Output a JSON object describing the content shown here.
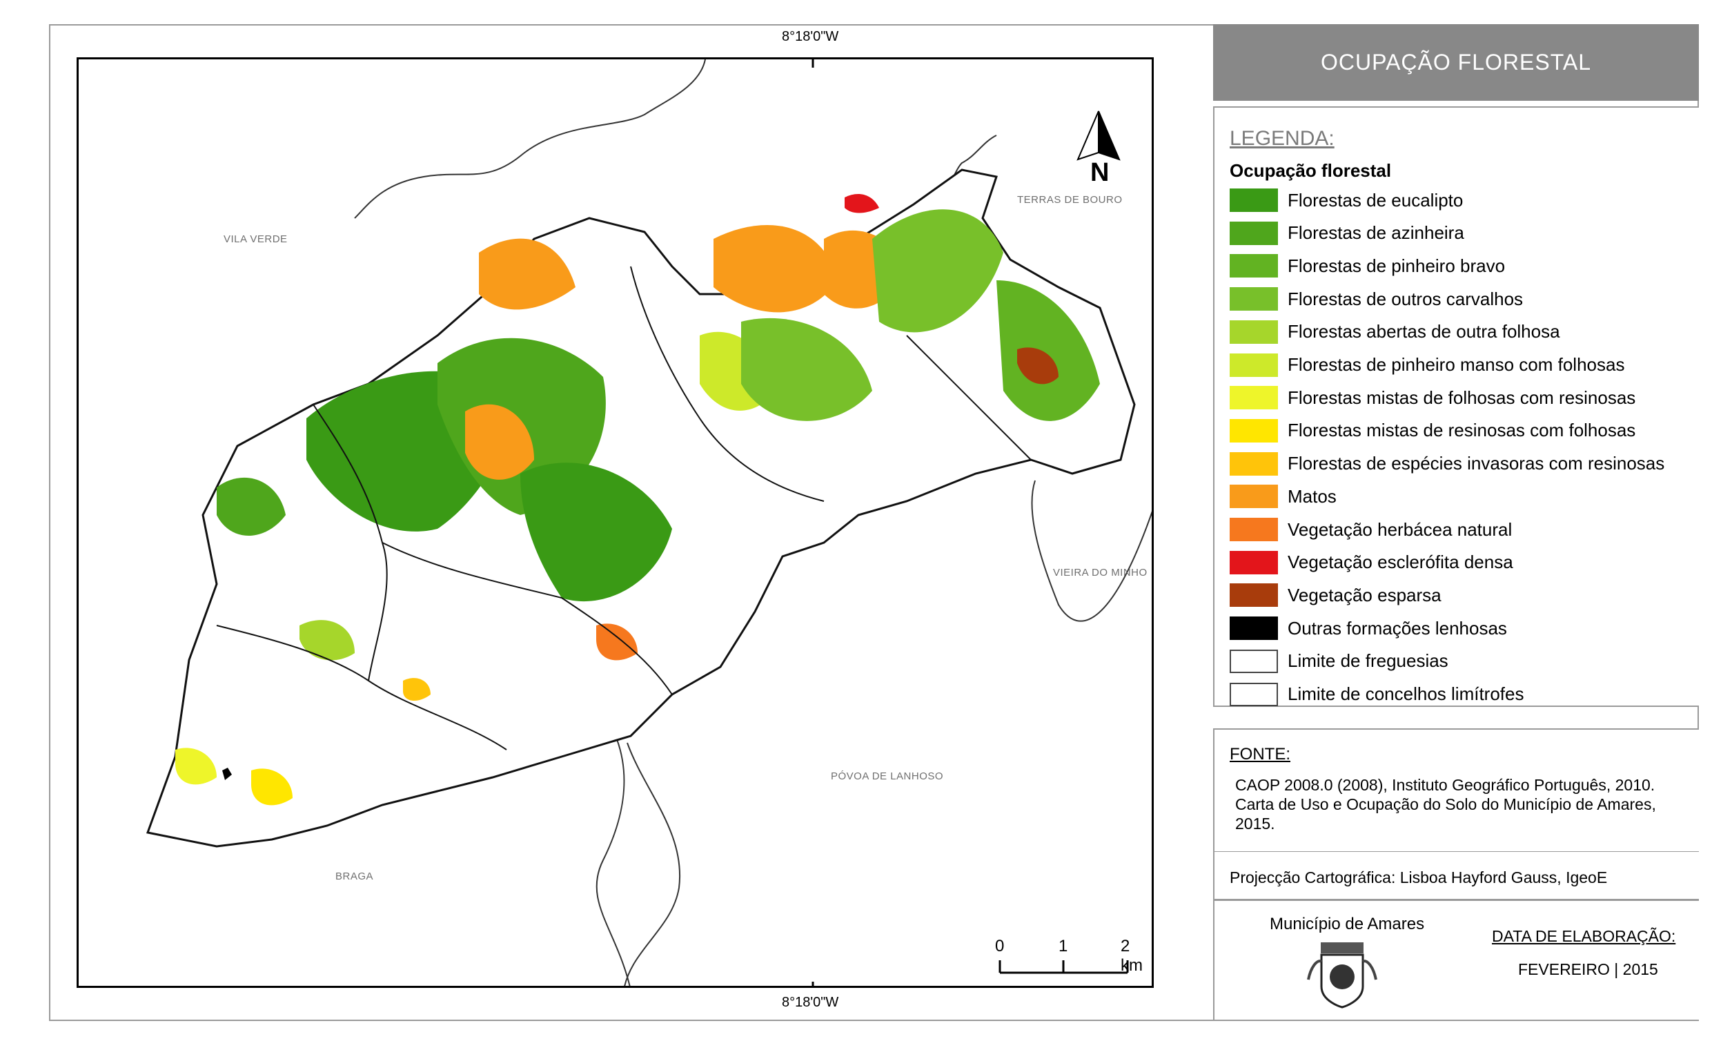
{
  "map": {
    "coord_top": "8°18'0\"W",
    "coord_bottom": "8°18'0\"W",
    "neighbors": [
      "VILA VERDE",
      "TERRAS DE BOURO",
      "VIEIRA DO MINHO",
      "PÓVOA DE LANHOSO",
      "BRAGA"
    ],
    "north_label": "N",
    "scale": {
      "labels": [
        "0",
        "1",
        "2 km"
      ]
    }
  },
  "title": "OCUPAÇÃO FLORESTAL",
  "legend": {
    "heading": "LEGENDA:",
    "subtitle": "Ocupação florestal",
    "items": [
      {
        "label": "Florestas de eucalipto",
        "color": "#3a9a15"
      },
      {
        "label": "Florestas de azinheira",
        "color": "#4fa61c"
      },
      {
        "label": "Florestas de pinheiro bravo",
        "color": "#62b322"
      },
      {
        "label": "Florestas de outros carvalhos",
        "color": "#78c02a"
      },
      {
        "label": "Florestas abertas de outra folhosa",
        "color": "#a6d62b"
      },
      {
        "label": "Florestas de pinheiro manso com folhosas",
        "color": "#cde92a"
      },
      {
        "label": "Florestas mistas de folhosas com resinosas",
        "color": "#eef52a"
      },
      {
        "label": "Florestas mistas de resinosas com folhosas",
        "color": "#ffe600"
      },
      {
        "label": "Florestas de espécies invasoras com resinosas",
        "color": "#ffc40a"
      },
      {
        "label": "Matos",
        "color": "#f99b1a"
      },
      {
        "label": "Vegetação herbácea natural",
        "color": "#f6781e"
      },
      {
        "label": "Vegetação esclerófita densa",
        "color": "#e3151b"
      },
      {
        "label": "Vegetação esparsa",
        "color": "#a83c0c"
      },
      {
        "label": "Outras formações lenhosas",
        "color": "#000000"
      },
      {
        "label": "Limite de freguesias",
        "color": "#ffffff"
      },
      {
        "label": "Limite de concelhos limítrofes",
        "color": "#ffffff"
      }
    ]
  },
  "source": {
    "heading": "FONTE:",
    "lines": [
      "CAOP 2008.0 (2008), Instituto Geográfico Português, 2010.",
      "Carta de Uso e Ocupação do Solo do Município de Amares,",
      "2015."
    ]
  },
  "projection": "Projecção Cartográfica: Lisboa Hayford Gauss, IgeoE",
  "footer": {
    "municipality": "Município de Amares",
    "date_heading": "DATA DE ELABORAÇÃO:",
    "date": "FEVEREIRO | 2015"
  }
}
